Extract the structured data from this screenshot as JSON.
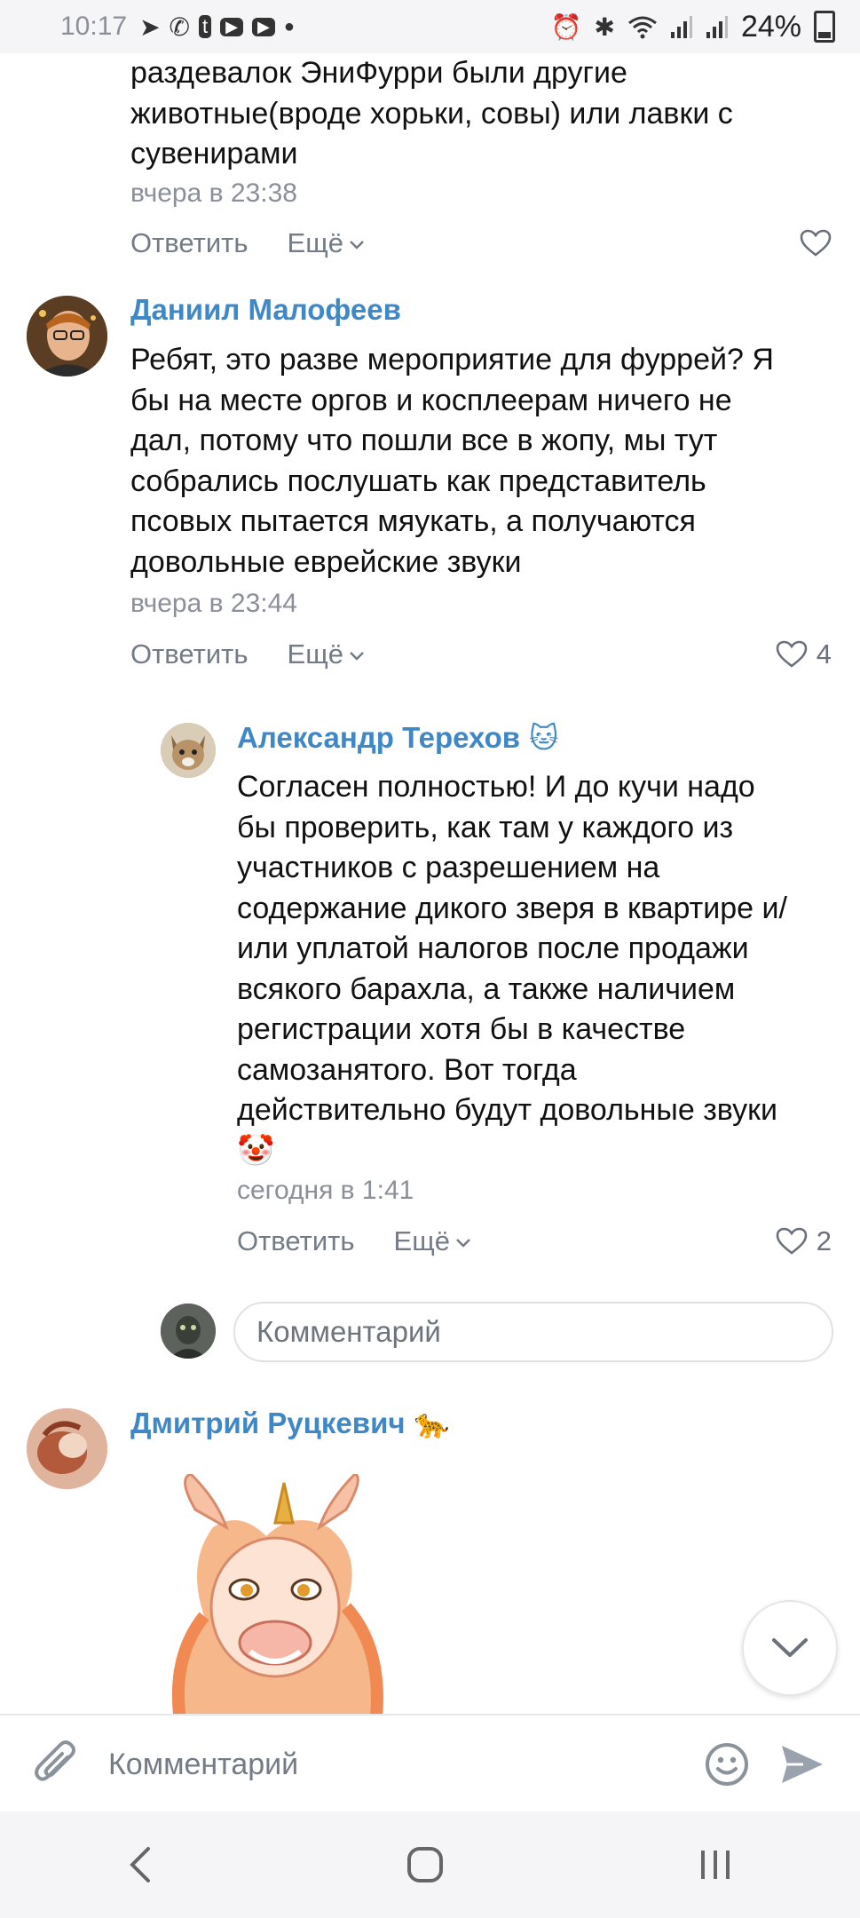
{
  "status_bar": {
    "time": "10:17",
    "battery": "24%",
    "left_icons": [
      "telegram-icon",
      "viber-icon",
      "tumblr-icon",
      "youtube-icon",
      "youtube-icon",
      "dot-icon"
    ],
    "right_icons": [
      "alarm-icon",
      "bluetooth-icon",
      "wifi-icon",
      "signal-icon",
      "signal-icon",
      "battery-icon"
    ]
  },
  "comments": [
    {
      "id": "c0",
      "text_lines": [
        "раздевалок ЭниФурри были другие",
        "животные(вроде хорьки, совы) или лавки с",
        "сувенирами"
      ],
      "time": "вчера в 23:38",
      "reply_label": "Ответить",
      "more_label": "Ещё",
      "likes": ""
    },
    {
      "id": "c1",
      "author": "Даниил Малофеев",
      "text_lines": [
        "Ребят, это разве мероприятие для фуррей? Я",
        "бы на месте оргов и косплеерам ничего не",
        "дал, потому что пошли все в жопу, мы тут",
        "собрались послушать как представитель",
        "псовых пытается мяукать, а получаются",
        "довольные еврейские звуки"
      ],
      "time": "вчера в 23:44",
      "reply_label": "Ответить",
      "more_label": "Ещё",
      "likes": "4"
    },
    {
      "id": "c2",
      "author": "Александр Терехов",
      "author_emoji": "🐱",
      "text_lines": [
        "Согласен полностью! И до кучи надо",
        "бы проверить, как там у каждого из",
        "участников с разрешением на",
        "содержание дикого зверя в квартире и/",
        "или уплатой налогов после продажи",
        "всякого барахла, а также наличием",
        "регистрации хотя бы в качестве",
        "самозанятого. Вот тогда",
        "действительно будут довольные звуки"
      ],
      "emoji_line": "🤡",
      "time": "сегодня в 1:41",
      "reply_label": "Ответить",
      "more_label": "Ещё",
      "likes": "2"
    },
    {
      "id": "c3",
      "author": "Дмитрий Руцкевич",
      "author_emoji": "🐆"
    }
  ],
  "reply_input": {
    "placeholder": "Комментарий"
  },
  "composer": {
    "placeholder": "Комментарий"
  },
  "colors": {
    "link": "#3f88c8",
    "secondary": "#8a8f99",
    "accent_send": "#99a2ad"
  }
}
